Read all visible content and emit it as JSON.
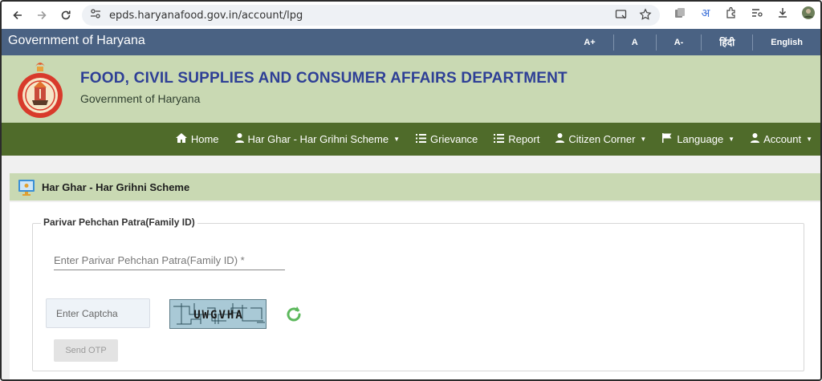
{
  "browser": {
    "url": "epds.haryanafood.gov.in/account/lpg",
    "translate_glyph": "अ"
  },
  "gov_bar": {
    "title": "Government of Haryana",
    "tools": [
      "A+",
      "A",
      "A-",
      "हिंदी",
      "English"
    ]
  },
  "header": {
    "department": "FOOD, CIVIL SUPPLIES AND CONSUMER AFFAIRS DEPARTMENT",
    "subtitle": "Government of Haryana"
  },
  "menu": {
    "items": [
      {
        "label": "Home",
        "icon": "home-icon",
        "dropdown": false
      },
      {
        "label": "Har Ghar - Har Grihni Scheme",
        "icon": "user-icon",
        "dropdown": true
      },
      {
        "label": "Grievance",
        "icon": "list-icon",
        "dropdown": false
      },
      {
        "label": "Report",
        "icon": "list-icon",
        "dropdown": false
      },
      {
        "label": "Citizen Corner",
        "icon": "user-icon",
        "dropdown": true
      },
      {
        "label": "Language",
        "icon": "flag-icon",
        "dropdown": true
      },
      {
        "label": "Account",
        "icon": "user-icon",
        "dropdown": true
      }
    ]
  },
  "page": {
    "title": "Har Ghar - Har Grihni Scheme",
    "fieldset_legend": "Parivar Pehchan Patra(Family ID)",
    "family_id_placeholder": "Enter Parivar Pehchan Patra(Family ID) *",
    "captcha_placeholder": "Enter Captcha",
    "captcha_text": "UWGVHA",
    "send_otp_label": "Send OTP"
  },
  "colors": {
    "gov_bar": "#4a6283",
    "header": "#c9d9b3",
    "menu": "#4f6b2a",
    "dept_title": "#2e3f96",
    "refresh": "#5cb85c"
  }
}
